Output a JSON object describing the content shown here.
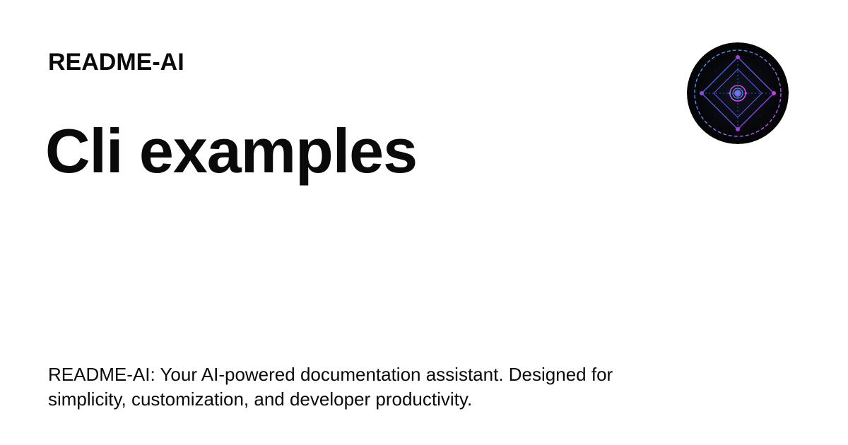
{
  "header": {
    "site_name": "README-AI"
  },
  "main": {
    "title": "Cli examples",
    "description": "README-AI: Your AI-powered documentation assistant. Designed for simplicity, customization, and developer productivity."
  },
  "logo": {
    "icon": "readme-ai-logo-icon",
    "colors": {
      "background": "#050505",
      "cyan": "#2aa8e0",
      "blue": "#3b6fe0",
      "purple": "#a63de6",
      "magenta": "#d946ef"
    }
  }
}
